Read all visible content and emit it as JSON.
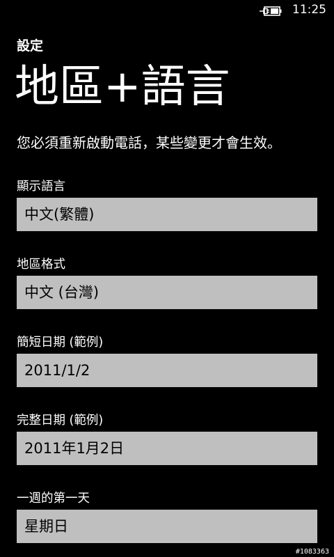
{
  "status_bar": {
    "time": "11:25",
    "battery_icon": "battery-charging-icon"
  },
  "header": {
    "app_title": "設定",
    "page_title": "地區+語言"
  },
  "notice": "您必須重新啟動電話，某些變更才會生效。",
  "fields": [
    {
      "label": "顯示語言",
      "value": "中文(繁體)"
    },
    {
      "label": "地區格式",
      "value": "中文 (台灣)"
    },
    {
      "label": "簡短日期 (範例)",
      "value": "2011/1/2"
    },
    {
      "label": "完整日期 (範例)",
      "value": "2011年1月2日"
    },
    {
      "label": "一週的第一天",
      "value": "星期日"
    }
  ],
  "watermark": "#1083363"
}
